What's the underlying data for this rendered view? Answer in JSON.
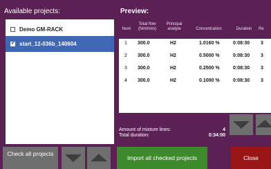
{
  "projects_title": "Available projects:",
  "projects": [
    {
      "label": "Demo GM-RACK",
      "checked": false,
      "selected": false
    },
    {
      "label": "start_12-036b_140604",
      "checked": true,
      "selected": true
    }
  ],
  "preview_title": "Preview:",
  "preview": {
    "columns": [
      "Num",
      "Total flow (Nml/min)",
      "Principal analyte",
      "Concentration",
      "Duration",
      "Re"
    ],
    "rows": [
      {
        "num": "1",
        "flow": "300.0",
        "analyte": "H2",
        "conc": "1.0160 %",
        "duration": "0:08:30",
        "rep": "3"
      },
      {
        "num": "2",
        "flow": "300.0",
        "analyte": "H2",
        "conc": "0.5000 %",
        "duration": "0:08:30",
        "rep": "3"
      },
      {
        "num": "3",
        "flow": "300.0",
        "analyte": "H2",
        "conc": "0.2500 %",
        "duration": "0:08:30",
        "rep": "3"
      },
      {
        "num": "4",
        "flow": "300.0",
        "analyte": "H2",
        "conc": "0.1000 %",
        "duration": "0:08:30",
        "rep": "3"
      }
    ]
  },
  "summary": {
    "lines_label": "Amount of mixture lines:",
    "lines_value": "4",
    "duration_label": "Total duration:",
    "duration_value": "0:34:00"
  },
  "buttons": {
    "check_all": "Check all projects",
    "import": "Import all checked projects",
    "close": "Close"
  },
  "colors": {
    "background": "#5b2155",
    "selected_row": "#3f67b3",
    "import_button": "#3d8a2c",
    "close_button": "#9a1616",
    "arrow_button": "#6f6f6f"
  }
}
